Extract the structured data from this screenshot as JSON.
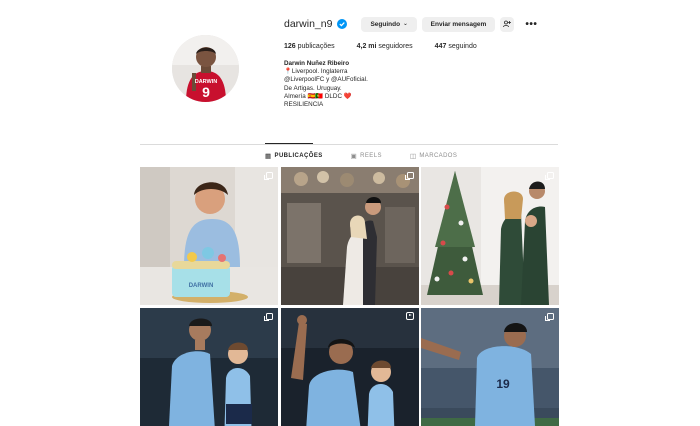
{
  "profile": {
    "username": "darwin_n9",
    "buttons": {
      "following": "Seguindo",
      "message": "Enviar mensagem"
    },
    "stats": {
      "posts_count": "126",
      "posts_label": "publicações",
      "followers_count": "4,2 mi",
      "followers_label": "seguidores",
      "following_count": "447",
      "following_label": "seguindo"
    },
    "bio": {
      "name": "Darwin Nuñez Ribeiro",
      "line1": "📍Liverpool. Inglaterra",
      "line2": "@LiverpoolFC y @AUFoficial.",
      "line3": "De Artigas. Uruguay.",
      "line4": "Almería 🇪🇸🇵🇹 DLDC ❤️",
      "line5": "RESILIENCIA"
    },
    "avatar_jersey_text": "DARWIN",
    "avatar_jersey_number": "9"
  },
  "tabs": [
    {
      "label": "PUBLICAÇÕES",
      "icon": "grid-icon",
      "active": true
    },
    {
      "label": "REELS",
      "icon": "reels-icon",
      "active": false
    },
    {
      "label": "MARCADOS",
      "icon": "tagged-icon",
      "active": false
    }
  ],
  "posts": [
    {
      "description_type": "multi",
      "cake_text": "DARWIN"
    },
    {
      "description_type": "multi"
    },
    {
      "description_type": "multi"
    },
    {
      "description_type": "multi"
    },
    {
      "description_type": "reel"
    },
    {
      "description_type": "multi",
      "shirt_number": "19"
    }
  ],
  "colors": {
    "verified": "#0095f6",
    "button_bg": "#efefef",
    "text": "#262626",
    "muted": "#8e8e8e",
    "liverpool_red": "#c8102e",
    "uruguay_sky": "#7fb3e0"
  }
}
